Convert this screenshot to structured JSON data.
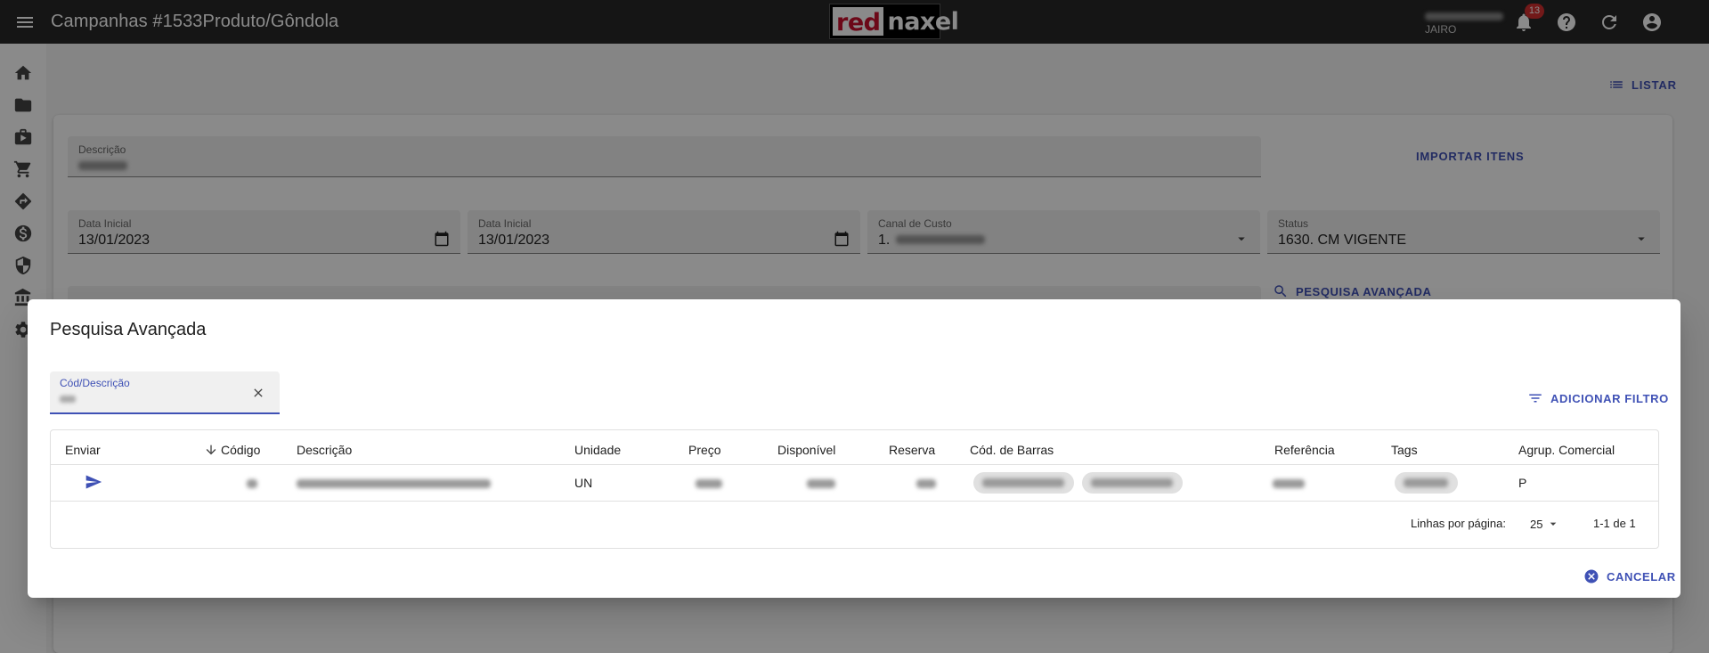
{
  "appbar": {
    "title": "Campanhas #1533Produto/Gôndola",
    "logo_red": "red",
    "logo_naxel": "naxel",
    "user_name": "JAIRO",
    "notification_count": "13"
  },
  "page": {
    "listar_label": "LISTAR",
    "descricao_label": "Descrição",
    "importar_label": "IMPORTAR ITENS",
    "data_inicial_1_label": "Data Inicial",
    "data_inicial_1_value": "13/01/2023",
    "data_inicial_2_label": "Data Inicial",
    "data_inicial_2_value": "13/01/2023",
    "canal_label": "Canal de Custo",
    "canal_value": "1.",
    "status_label": "Status",
    "status_value": "1630. CM VIGENTE",
    "pesquisa_avancada_link": "PESQUISA AVANÇADA"
  },
  "dialog": {
    "title": "Pesquisa Avançada",
    "search_label": "Cód/Descrição",
    "add_filter_label": "ADICIONAR FILTRO",
    "cancel_label": "CANCELAR",
    "columns": {
      "enviar": "Enviar",
      "codigo": "Código",
      "descricao": "Descrição",
      "unidade": "Unidade",
      "preco": "Preço",
      "disponivel": "Disponível",
      "reserva": "Reserva",
      "cod_barras": "Cód. de Barras",
      "referencia": "Referência",
      "tags": "Tags",
      "agrup": "Agrup. Comercial"
    },
    "row": {
      "unidade": "UN",
      "agrup": "P"
    },
    "rows_per_page_label": "Linhas por página:",
    "rows_per_page_value": "25",
    "pagination_text": "1-1 de 1"
  },
  "colors": {
    "appbar": "#272727",
    "accent": "#3f51b5",
    "badge": "#d32f2f"
  }
}
